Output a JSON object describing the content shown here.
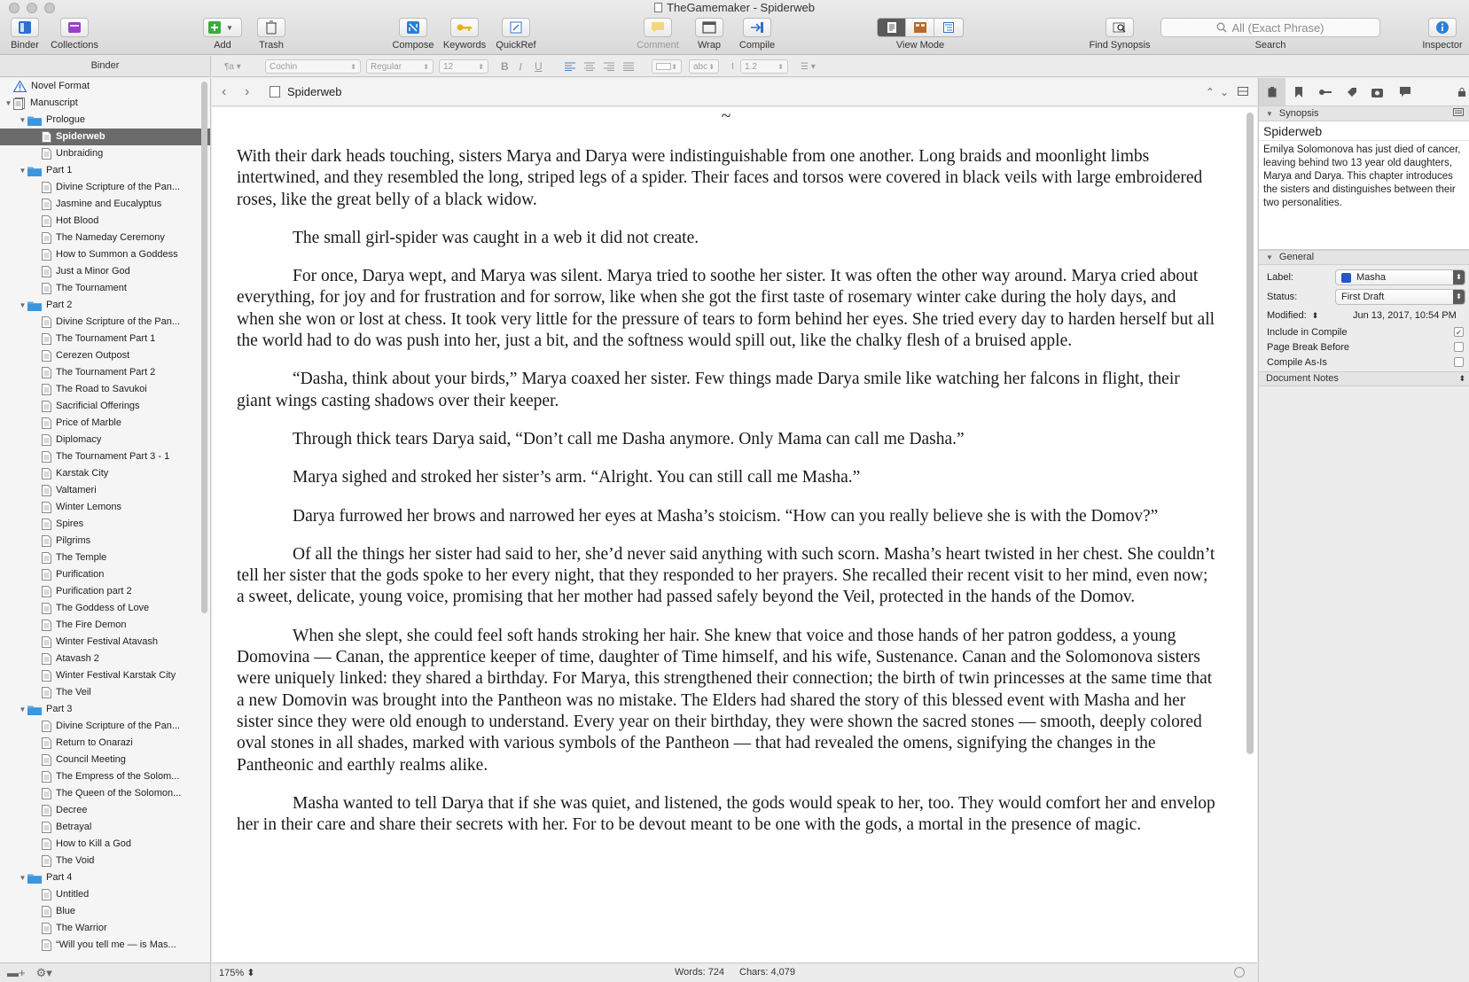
{
  "window": {
    "title": "TheGamemaker - Spiderweb"
  },
  "toolbar": {
    "binder": "Binder",
    "collections": "Collections",
    "add": "Add",
    "trash": "Trash",
    "compose": "Compose",
    "keywords": "Keywords",
    "quickref": "QuickRef",
    "comment": "Comment",
    "wrap": "Wrap",
    "compile": "Compile",
    "view_mode": "View Mode",
    "find_synopsis": "Find Synopsis",
    "search_placeholder": "All (Exact Phrase)",
    "search": "Search",
    "inspector": "Inspector"
  },
  "format_bar": {
    "font": "Cochin",
    "style": "Regular",
    "size": "12",
    "line_spacing": "1.2",
    "highlight": "abc"
  },
  "binder": {
    "header": "Binder",
    "items": [
      {
        "label": "Novel Format",
        "level": 0,
        "icon": "warning-icon",
        "disclosure": "none"
      },
      {
        "label": "Manuscript",
        "level": 0,
        "icon": "manuscript-icon",
        "disclosure": "open"
      },
      {
        "label": "Prologue",
        "level": 1,
        "icon": "folder-icon",
        "disclosure": "open"
      },
      {
        "label": "Spiderweb",
        "level": 2,
        "icon": "document-icon",
        "disclosure": "none",
        "selected": true
      },
      {
        "label": "Unbraiding",
        "level": 2,
        "icon": "document-icon",
        "disclosure": "none"
      },
      {
        "label": "Part 1",
        "level": 1,
        "icon": "folder-icon",
        "disclosure": "open"
      },
      {
        "label": "Divine Scripture of the Pan...",
        "level": 2,
        "icon": "document-icon",
        "disclosure": "none"
      },
      {
        "label": "Jasmine and Eucalyptus",
        "level": 2,
        "icon": "document-icon",
        "disclosure": "none"
      },
      {
        "label": "Hot Blood",
        "level": 2,
        "icon": "document-icon",
        "disclosure": "none"
      },
      {
        "label": "The Nameday Ceremony",
        "level": 2,
        "icon": "document-icon",
        "disclosure": "none"
      },
      {
        "label": "How to Summon a Goddess",
        "level": 2,
        "icon": "document-icon",
        "disclosure": "none"
      },
      {
        "label": "Just a Minor God",
        "level": 2,
        "icon": "document-icon",
        "disclosure": "none"
      },
      {
        "label": "The Tournament",
        "level": 2,
        "icon": "document-icon",
        "disclosure": "none"
      },
      {
        "label": "Part 2",
        "level": 1,
        "icon": "folder-icon",
        "disclosure": "open"
      },
      {
        "label": "Divine Scripture of the Pan...",
        "level": 2,
        "icon": "document-icon",
        "disclosure": "none"
      },
      {
        "label": "The Tournament Part 1",
        "level": 2,
        "icon": "document-icon",
        "disclosure": "none"
      },
      {
        "label": "Cerezen Outpost",
        "level": 2,
        "icon": "document-icon",
        "disclosure": "none"
      },
      {
        "label": "The Tournament Part 2",
        "level": 2,
        "icon": "document-icon",
        "disclosure": "none"
      },
      {
        "label": "The Road to Savukoi",
        "level": 2,
        "icon": "document-icon",
        "disclosure": "none"
      },
      {
        "label": "Sacrificial Offerings",
        "level": 2,
        "icon": "document-icon",
        "disclosure": "none"
      },
      {
        "label": "Price of Marble",
        "level": 2,
        "icon": "document-icon",
        "disclosure": "none"
      },
      {
        "label": "Diplomacy",
        "level": 2,
        "icon": "document-icon",
        "disclosure": "none"
      },
      {
        "label": "The Tournament Part 3 - 1",
        "level": 2,
        "icon": "document-icon",
        "disclosure": "none"
      },
      {
        "label": "Karstak City",
        "level": 2,
        "icon": "document-icon",
        "disclosure": "none"
      },
      {
        "label": "Valtameri",
        "level": 2,
        "icon": "document-icon",
        "disclosure": "none"
      },
      {
        "label": "Winter Lemons",
        "level": 2,
        "icon": "document-icon",
        "disclosure": "none"
      },
      {
        "label": "Spires",
        "level": 2,
        "icon": "document-icon",
        "disclosure": "none"
      },
      {
        "label": "Pilgrims",
        "level": 2,
        "icon": "document-icon",
        "disclosure": "none"
      },
      {
        "label": "The Temple",
        "level": 2,
        "icon": "document-icon",
        "disclosure": "none"
      },
      {
        "label": "Purification",
        "level": 2,
        "icon": "document-icon",
        "disclosure": "none"
      },
      {
        "label": "Purification part 2",
        "level": 2,
        "icon": "document-icon",
        "disclosure": "none"
      },
      {
        "label": "The Goddess of Love",
        "level": 2,
        "icon": "document-icon",
        "disclosure": "none"
      },
      {
        "label": "The Fire Demon",
        "level": 2,
        "icon": "document-icon",
        "disclosure": "none"
      },
      {
        "label": "Winter Festival Atavash",
        "level": 2,
        "icon": "document-icon",
        "disclosure": "none"
      },
      {
        "label": "Atavash 2",
        "level": 2,
        "icon": "document-icon",
        "disclosure": "none"
      },
      {
        "label": "Winter Festival Karstak City",
        "level": 2,
        "icon": "document-icon",
        "disclosure": "none"
      },
      {
        "label": "The Veil",
        "level": 2,
        "icon": "document-icon",
        "disclosure": "none"
      },
      {
        "label": "Part 3",
        "level": 1,
        "icon": "folder-icon",
        "disclosure": "open"
      },
      {
        "label": "Divine Scripture of the Pan...",
        "level": 2,
        "icon": "document-icon",
        "disclosure": "none"
      },
      {
        "label": "Return to Onarazi",
        "level": 2,
        "icon": "document-icon",
        "disclosure": "none"
      },
      {
        "label": "Council Meeting",
        "level": 2,
        "icon": "document-icon",
        "disclosure": "none"
      },
      {
        "label": "The Empress of the Solom...",
        "level": 2,
        "icon": "document-icon",
        "disclosure": "none"
      },
      {
        "label": "The Queen of the Solomon...",
        "level": 2,
        "icon": "document-icon",
        "disclosure": "none"
      },
      {
        "label": "Decree",
        "level": 2,
        "icon": "document-icon",
        "disclosure": "none"
      },
      {
        "label": "Betrayal",
        "level": 2,
        "icon": "document-icon",
        "disclosure": "none"
      },
      {
        "label": "How to Kill a God",
        "level": 2,
        "icon": "document-icon",
        "disclosure": "none"
      },
      {
        "label": "The Void",
        "level": 2,
        "icon": "document-icon",
        "disclosure": "none"
      },
      {
        "label": "Part 4",
        "level": 1,
        "icon": "folder-icon",
        "disclosure": "open"
      },
      {
        "label": "Untitled",
        "level": 2,
        "icon": "document-icon",
        "disclosure": "none"
      },
      {
        "label": "Blue",
        "level": 2,
        "icon": "document-icon",
        "disclosure": "none"
      },
      {
        "label": "The Warrior",
        "level": 2,
        "icon": "document-icon",
        "disclosure": "none"
      },
      {
        "label": "“Will you tell me — is Mas...",
        "level": 2,
        "icon": "document-icon",
        "disclosure": "none"
      }
    ]
  },
  "editor": {
    "doc_title": "Spiderweb",
    "ornament": "~",
    "paragraphs": [
      "With their dark heads touching, sisters Marya and Darya were indistinguishable from one another. Long braids and moonlight limbs intertwined, and they resembled the long, striped legs of a spider. Their faces and torsos were covered in black veils with large embroidered roses, like the great belly of a black widow.",
      "The small girl-spider was caught in a web it did not create.",
      "For once, Darya wept, and Marya was silent. Marya tried to soothe her sister. It was often the other way around. Marya cried about everything, for joy and for frustration and for sorrow, like when she got the first taste of rosemary winter cake during the holy days, and when she won or lost at chess. It took very little for the pressure of tears to form behind her eyes. She tried every day to harden herself but all the world had to do was push into her, just a bit, and the softness would spill out, like the chalky flesh of a bruised apple.",
      "“Dasha, think about your birds,” Marya coaxed her sister. Few things made Darya smile like watching her falcons in flight, their giant wings casting shadows over their keeper.",
      "Through thick tears Darya said, “Don’t call me Dasha anymore. Only Mama can call me Dasha.”",
      "Marya sighed and stroked her sister’s arm. “Alright. You can still call me Masha.”",
      "Darya furrowed her brows and narrowed her eyes at Masha’s stoicism. “How can you really believe she is with the Domov?”",
      "Of all the things her sister had said to her, she’d never said anything with such scorn. Masha’s heart twisted in her chest. She couldn’t tell her sister that the gods spoke to her every night, that they responded to her prayers. She recalled their recent visit to her mind, even now; a sweet, delicate, young voice, promising that her mother had passed safely beyond the Veil, protected in the hands of the Domov.",
      "When she slept, she could feel soft hands stroking her hair. She knew that voice and those hands of her patron goddess, a young Domovina — Canan, the apprentice keeper of time, daughter of Time himself, and his wife, Sustenance. Canan and the Solomonova sisters were uniquely linked: they shared a birthday. For Marya, this strengthened their connection; the birth of twin princesses at the same time that a new Domovin was brought into the Pantheon was no mistake. The Elders had shared the story of this blessed event with Masha and her sister since they were old enough to understand. Every year on their birthday, they were shown the sacred stones — smooth, deeply colored oval stones in all shades, marked with various symbols of the Pantheon — that had revealed the omens, signifying the changes in the Pantheonic and earthly realms alike.",
      "Masha wanted to tell Darya that if she was quiet, and listened, the gods would speak to her, too. They would comfort her and envelop her in their care and share their secrets with her. For to be devout meant to be one with the gods, a mortal in the presence of magic."
    ]
  },
  "footer": {
    "zoom": "175%",
    "words": "Words: 724",
    "chars": "Chars: 4,079"
  },
  "inspector": {
    "synopsis_header": "Synopsis",
    "synopsis_title": "Spiderweb",
    "synopsis_text": "Emilya Solomonova has just died of cancer, leaving behind two 13 year old daughters, Marya and Darya. This chapter introduces the sisters and distinguishes between their two personalities.",
    "general_header": "General",
    "label_caption": "Label:",
    "label_value": "Masha",
    "label_color": "#2457c5",
    "status_caption": "Status:",
    "status_value": "First Draft",
    "modified_caption": "Modified:",
    "modified_value": "Jun 13, 2017, 10:54 PM",
    "include_in_compile": "Include in Compile",
    "include_checked": "✓",
    "page_break_before": "Page Break Before",
    "compile_as_is": "Compile As-Is",
    "document_notes": "Document Notes"
  }
}
